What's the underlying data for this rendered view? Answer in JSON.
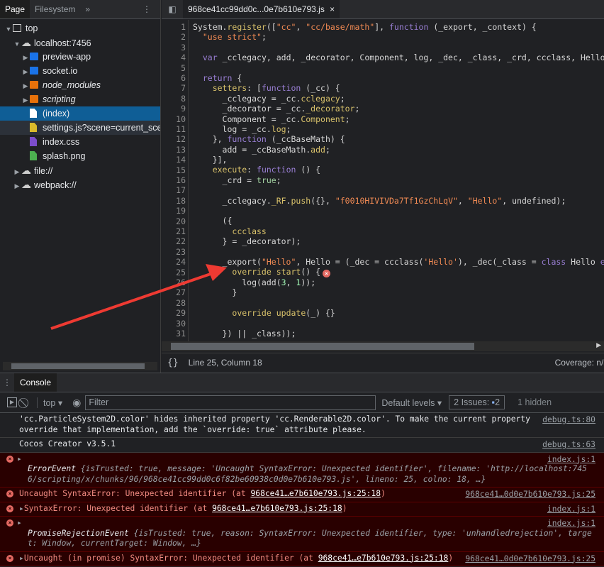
{
  "left": {
    "tabs": [
      "Page",
      "Filesystem"
    ],
    "more": "»",
    "menu": "⋮",
    "tree": [
      {
        "label": "top",
        "type": "frame",
        "depth": 0,
        "open": true
      },
      {
        "label": "localhost:7456",
        "type": "cloud",
        "depth": 1,
        "open": true
      },
      {
        "label": "preview-app",
        "type": "folder",
        "color": "#1a73e8",
        "depth": 2
      },
      {
        "label": "socket.io",
        "type": "folder",
        "color": "#1a73e8",
        "depth": 2
      },
      {
        "label": "node_modules",
        "type": "folder",
        "color": "#e8710a",
        "depth": 2,
        "italic": true
      },
      {
        "label": "scripting",
        "type": "folder",
        "color": "#e8710a",
        "depth": 2,
        "italic": true
      },
      {
        "label": "(index)",
        "type": "file",
        "color": "#ffffff",
        "depth": 2,
        "selected": true
      },
      {
        "label": "settings.js?scene=current_scene",
        "type": "file",
        "color": "#d9b92b",
        "depth": 2,
        "hover": true
      },
      {
        "label": "index.css",
        "type": "file",
        "color": "#7c4dcc",
        "depth": 2
      },
      {
        "label": "splash.png",
        "type": "file",
        "color": "#4caf50",
        "depth": 2
      },
      {
        "label": "file://",
        "type": "cloud",
        "depth": 1
      },
      {
        "label": "webpack://",
        "type": "cloud",
        "depth": 1
      }
    ]
  },
  "editor": {
    "tab": "968ce41cc99dd0c...0e7b610e793.js",
    "close": "×",
    "lines": [
      [
        [
          "",
          "System."
        ],
        [
          "p",
          "register"
        ],
        [
          "",
          "(["
        ],
        [
          "s",
          "\"cc\""
        ],
        [
          "",
          ", "
        ],
        [
          "s",
          "\"cc/base/math\""
        ],
        [
          "",
          "], "
        ],
        [
          "k",
          "function"
        ],
        [
          "",
          " (_export, _context) {"
        ]
      ],
      [
        [
          "",
          "  "
        ],
        [
          "s",
          "\"use strict\""
        ],
        [
          "",
          ";"
        ]
      ],
      [],
      [
        [
          "",
          "  "
        ],
        [
          "k",
          "var"
        ],
        [
          "",
          " _cclegacy, add, _decorator, Component, log, _dec, _class, _crd, ccclass, Hello;"
        ]
      ],
      [],
      [
        [
          "",
          "  "
        ],
        [
          "k",
          "return"
        ],
        [
          "",
          " {"
        ]
      ],
      [
        [
          "",
          "    "
        ],
        [
          "p",
          "setters"
        ],
        [
          "",
          ": ["
        ],
        [
          "k",
          "function"
        ],
        [
          "",
          " (_cc) {"
        ]
      ],
      [
        [
          "",
          "      _cclegacy = _cc."
        ],
        [
          "p",
          "cclegacy"
        ],
        [
          "",
          ";"
        ]
      ],
      [
        [
          "",
          "      _decorator = _cc."
        ],
        [
          "p",
          "_decorator"
        ],
        [
          "",
          ";"
        ]
      ],
      [
        [
          "",
          "      Component = _cc."
        ],
        [
          "p",
          "Component"
        ],
        [
          "",
          ";"
        ]
      ],
      [
        [
          "",
          "      log = _cc."
        ],
        [
          "p",
          "log"
        ],
        [
          "",
          ";"
        ]
      ],
      [
        [
          "",
          "    }, "
        ],
        [
          "k",
          "function"
        ],
        [
          "",
          " (_ccBaseMath) {"
        ]
      ],
      [
        [
          "",
          "      add = _ccBaseMath."
        ],
        [
          "p",
          "add"
        ],
        [
          "",
          ";"
        ]
      ],
      [
        [
          "",
          "    }],"
        ]
      ],
      [
        [
          "",
          "    "
        ],
        [
          "p",
          "execute"
        ],
        [
          "",
          ": "
        ],
        [
          "k",
          "function"
        ],
        [
          "",
          " () {"
        ]
      ],
      [
        [
          "",
          "      _crd = "
        ],
        [
          "a",
          "true"
        ],
        [
          "",
          ";"
        ]
      ],
      [],
      [
        [
          "",
          "      _cclegacy."
        ],
        [
          "p",
          "_RF"
        ],
        [
          "",
          "."
        ],
        [
          "p",
          "push"
        ],
        [
          "",
          "({}, "
        ],
        [
          "s",
          "\"f0010HIVIVDa7Tf1GzChLqV\""
        ],
        [
          "",
          ", "
        ],
        [
          "s",
          "\"Hello\""
        ],
        [
          "",
          ", undefined);"
        ]
      ],
      [],
      [
        [
          "",
          "      ({"
        ]
      ],
      [
        [
          "",
          "        "
        ],
        [
          "p",
          "ccclass"
        ]
      ],
      [
        [
          "",
          "      } = _decorator);"
        ]
      ],
      [],
      [
        [
          "",
          "      _export("
        ],
        [
          "s",
          "\"Hello\""
        ],
        [
          "",
          ", Hello = (_dec = ccclass("
        ],
        [
          "s",
          "'Hello'"
        ],
        [
          "",
          "), _dec(_class = "
        ],
        [
          "k",
          "class"
        ],
        [
          "",
          " Hello "
        ],
        [
          "k",
          "extends"
        ],
        [
          "",
          " Component {"
        ]
      ],
      [
        [
          "",
          "        "
        ],
        [
          "p",
          "override"
        ],
        [
          "",
          " "
        ],
        [
          "p",
          "start"
        ],
        [
          "",
          "() {"
        ]
      ],
      [
        [
          "",
          "          log(add("
        ],
        [
          "n",
          "3"
        ],
        [
          "",
          ", "
        ],
        [
          "n",
          "1"
        ],
        [
          "",
          "));"
        ]
      ],
      [
        [
          "",
          "        }"
        ]
      ],
      [],
      [
        [
          "",
          "        "
        ],
        [
          "p",
          "override"
        ],
        [
          "",
          " "
        ],
        [
          "p",
          "update"
        ],
        [
          "",
          "(_) {}"
        ]
      ],
      [],
      [
        [
          "",
          "      }) || _class));"
        ]
      ]
    ],
    "error_line": 25,
    "status": {
      "braces": "{}",
      "position": "Line 25, Column 18",
      "coverage": "Coverage: n/a"
    }
  },
  "console": {
    "tab": "Console",
    "context": "top",
    "filter_placeholder": "Filter",
    "levels": "Default levels ▾",
    "issues": "2 Issues:",
    "issues_count": "2",
    "hidden": "1 hidden",
    "messages": [
      {
        "type": "warn",
        "text": "'cc.ParticleSystem2D.color' hides inherited property 'cc.Renderable2D.color'. To make the current property override that implementation, add the `override: true` attribute please.",
        "src": "debug.ts:80"
      },
      {
        "type": "log",
        "text": "Cocos Creator v3.5.1",
        "src": "debug.ts:63"
      },
      {
        "type": "error",
        "expand": true,
        "obj": "ErrorEvent",
        "text": "{isTrusted: true, message: 'Uncaught SyntaxError: Unexpected identifier', filename: 'http://localhost:7456/scripting/x/chunks/96/968ce41cc99dd0c6f82be60938c0d0e7b610e793.js', lineno: 25, colno: 18, …}",
        "src": "index.js:1"
      },
      {
        "type": "error",
        "text": "Uncaught SyntaxError: Unexpected identifier (at ",
        "link": "968ce41…e7b610e793.js:25:18",
        "tail": ")",
        "src": "968ce41…0d0e7b610e793.js:25"
      },
      {
        "type": "error",
        "arrow": true,
        "text": "SyntaxError: Unexpected identifier (at ",
        "link": "968ce41…e7b610e793.js:25:18",
        "tail": ")",
        "src": "index.js:1"
      },
      {
        "type": "error",
        "expand": true,
        "obj": "PromiseRejectionEvent",
        "text": "{isTrusted: true, reason: SyntaxError: Unexpected identifier, type: 'unhandledrejection', target: Window, currentTarget: Window, …}",
        "src": "index.js:1"
      },
      {
        "type": "error",
        "arrow": true,
        "text": "Uncaught (in promise) SyntaxError: Unexpected identifier (at ",
        "link": "968ce41…e7b610e793.js:25:18",
        "tail": ")",
        "src": "968ce41…0d0e7b610e793.js:25"
      }
    ]
  },
  "colors": {
    "accent": "#0f5e96",
    "error_bg": "#290000",
    "error_text": "#f28b82",
    "annotation_arrow": "#ee3a32"
  }
}
